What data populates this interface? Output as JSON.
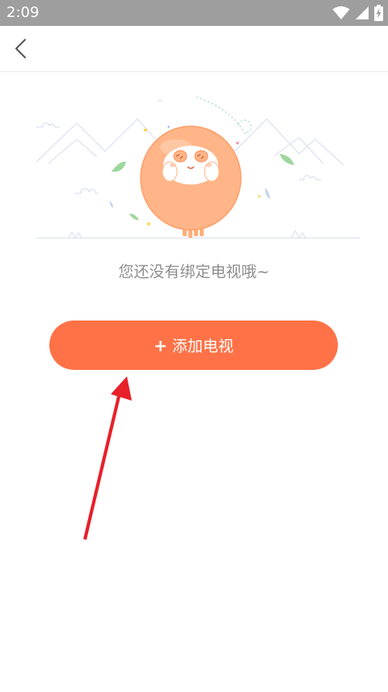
{
  "status_bar": {
    "time": "2:09",
    "icons": [
      "wifi-icon",
      "cell-signal-icon",
      "battery-charging-icon"
    ]
  },
  "app_bar": {
    "back_icon": "chevron-left-icon"
  },
  "empty_state": {
    "illustration": "empty-tv-mascot-illustration",
    "message": "您还没有绑定电视哦~"
  },
  "add_button": {
    "plus": "+",
    "label": "添加电视"
  },
  "colors": {
    "status_bar": "#9e9e9e",
    "accent": "#ff7247",
    "mascot": "#ffae7a",
    "text_muted": "#8e8e8e",
    "annotation": "#e8202a"
  }
}
